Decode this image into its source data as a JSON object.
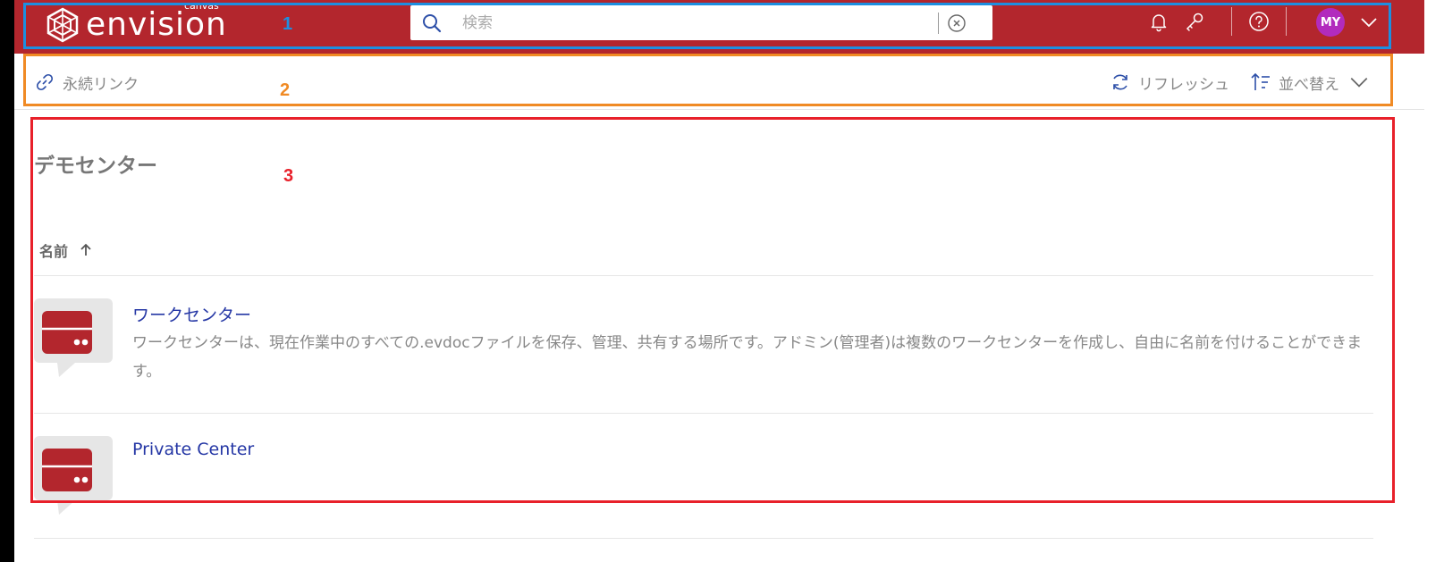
{
  "header": {
    "logo_text": "envision",
    "logo_sub": "canvas",
    "search_placeholder": "検索",
    "avatar_initials": "MY",
    "colors": {
      "brand": "#b3262d",
      "avatar": "#b22bbd"
    },
    "icons": [
      "search-icon",
      "clear-icon",
      "bell-icon",
      "key-icon",
      "help-icon",
      "chevron-down-icon"
    ]
  },
  "toolbar": {
    "permalink_label": "永続リンク",
    "refresh_label": "リフレッシュ",
    "sort_label": "並べ替え"
  },
  "main": {
    "title": "デモセンター",
    "column_header": "名前",
    "items": [
      {
        "name": "ワークセンター",
        "description": "ワークセンターは、現在作業中のすべての.evdocファイルを保存、管理、共有する場所です。アドミン(管理者)は複数のワークセンターを作成し、自由に名前を付けることができます。"
      },
      {
        "name": "Private Center",
        "description": ""
      }
    ]
  },
  "annotations": [
    {
      "label": "1",
      "color": "#1d8fe0"
    },
    {
      "label": "2",
      "color": "#f08a24"
    },
    {
      "label": "3",
      "color": "#e8202a"
    }
  ]
}
